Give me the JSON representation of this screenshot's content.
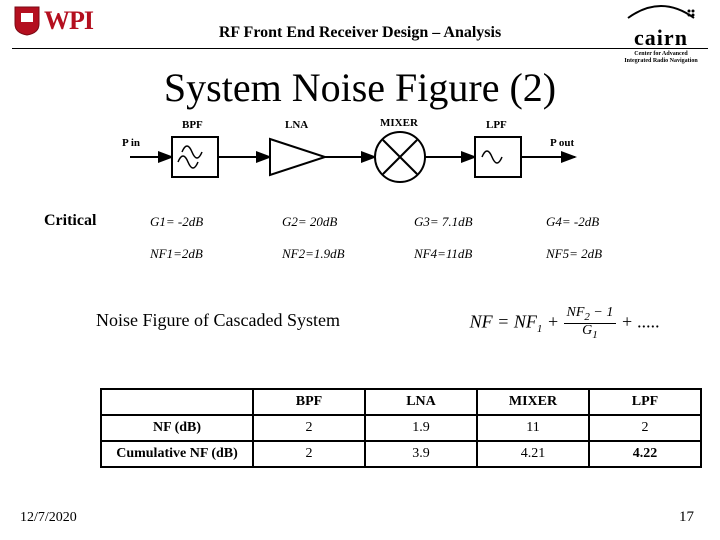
{
  "header": {
    "title": "RF Front End Receiver Design – Analysis",
    "wpi": "WPI",
    "cairn": "cairn",
    "cairn_sub1": "Center for Advanced",
    "cairn_sub2": "Integrated Radio Navigation"
  },
  "title": "System Noise Figure (2)",
  "diagram": {
    "pin": "P in",
    "bpf": "BPF",
    "lna": "LNA",
    "mixer": "MIXER",
    "lpf": "LPF",
    "pout": "P out"
  },
  "critical_label": "Critical",
  "gains": {
    "g1": "G1= -2dB",
    "g2": "G2= 20dB",
    "g3": "G3= 7.1dB",
    "g4": "G4= -2dB"
  },
  "nfs": {
    "nf1": "NF1=2dB",
    "nf2": "NF2=1.9dB",
    "nf4": "NF4=11dB",
    "nf5": "NF5= 2dB"
  },
  "cascaded_label": "Noise Figure of Cascaded System",
  "formula": {
    "lhs_nf": "NF",
    "eq": " = ",
    "nf1": "NF",
    "plus": " + ",
    "num": "NF",
    "num_sub": "2",
    "minus1": " − 1",
    "den": "G",
    "den_sub": "1",
    "dots": " + ....."
  },
  "table": {
    "cols": [
      "BPF",
      "LNA",
      "MIXER",
      "LPF"
    ],
    "rows": [
      {
        "hdr": "NF (dB)",
        "vals": [
          "2",
          "1.9",
          "11",
          "2"
        ]
      },
      {
        "hdr": "Cumulative NF (dB)",
        "vals": [
          "2",
          "3.9",
          "4.21",
          "4.22"
        ]
      }
    ]
  },
  "footer": {
    "date": "12/7/2020",
    "page": "17"
  }
}
